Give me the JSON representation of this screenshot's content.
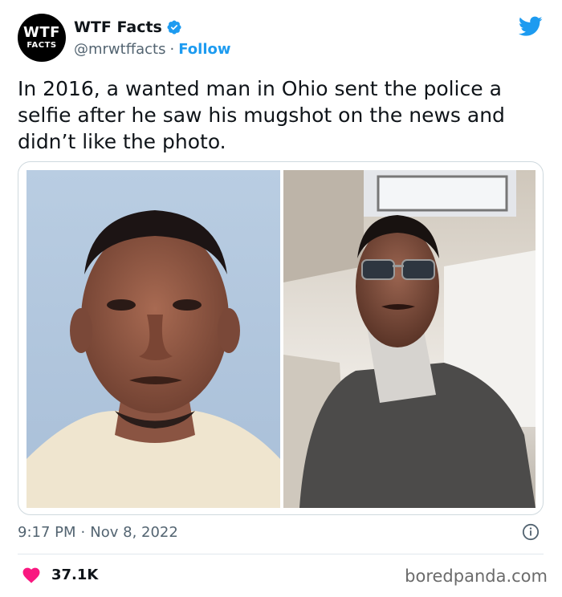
{
  "account": {
    "avatar_line1": "WTF",
    "avatar_line2": "FACTS",
    "display_name": "WTF Facts",
    "handle": "@mrwtffacts",
    "separator": "·",
    "follow_label": "Follow"
  },
  "tweet": {
    "text": "In 2016, a wanted man in Ohio sent the police a selfie after he saw his mugshot on the news and didn’t like the photo.",
    "time": "9:17 PM",
    "date": "Nov 8, 2022",
    "like_count": "37.1K"
  },
  "icons": {
    "verified": "verified-badge-icon",
    "brand": "twitter-bird-icon",
    "info": "info-icon",
    "like": "heart-icon"
  },
  "colors": {
    "accent": "#1d9bf0",
    "like": "#f91880",
    "text": "#0f1419",
    "muted": "#536471"
  },
  "watermark": "boredpanda.com"
}
